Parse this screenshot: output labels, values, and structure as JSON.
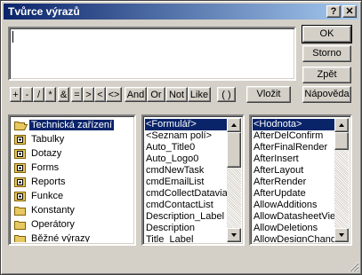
{
  "window": {
    "title": "Tvůrce výrazů",
    "help_glyph": "?",
    "close_glyph": "✕"
  },
  "buttons": {
    "ok": "OK",
    "cancel": "Storno",
    "back": "Zpět",
    "paste": "Vložit",
    "help": "Nápověda"
  },
  "operators": [
    "+",
    "-",
    "/",
    "*",
    "&",
    "=",
    ">",
    "<",
    "<>",
    "And",
    "Or",
    "Not",
    "Like",
    "( )"
  ],
  "expression_box": {
    "value": ""
  },
  "tree": {
    "items": [
      {
        "label": "Technická zařízení",
        "icon": "folder-open-icon",
        "selected": true
      },
      {
        "label": "Tabulky",
        "icon": "folder-plus-icon",
        "selected": false
      },
      {
        "label": "Dotazy",
        "icon": "folder-plus-icon",
        "selected": false
      },
      {
        "label": "Forms",
        "icon": "folder-plus-icon",
        "selected": false
      },
      {
        "label": "Reports",
        "icon": "folder-plus-icon",
        "selected": false
      },
      {
        "label": "Funkce",
        "icon": "folder-plus-icon",
        "selected": false
      },
      {
        "label": "Konstanty",
        "icon": "folder-icon",
        "selected": false
      },
      {
        "label": "Operátory",
        "icon": "folder-icon",
        "selected": false
      },
      {
        "label": "Běžné výrazy",
        "icon": "folder-icon",
        "selected": false
      }
    ]
  },
  "middle_list": {
    "items": [
      "<Formulář>",
      "<Seznam polí>",
      "Auto_Title0",
      "Auto_Logo0",
      "cmdNewTask",
      "cmdEmailList",
      "cmdCollectDataviaE",
      "cmdContactList",
      "Description_Label",
      "Description",
      "Title_Label"
    ]
  },
  "right_list": {
    "items": [
      "<Hodnota>",
      "AfterDelConfirm",
      "AfterFinalRender",
      "AfterInsert",
      "AfterLayout",
      "AfterRender",
      "AfterUpdate",
      "AllowAdditions",
      "AllowDatasheetView",
      "AllowDeletions",
      "AllowDesignChange"
    ]
  },
  "colors": {
    "selection": "#0a246a",
    "face": "#d4d0c8",
    "folder": "#e8c860"
  }
}
